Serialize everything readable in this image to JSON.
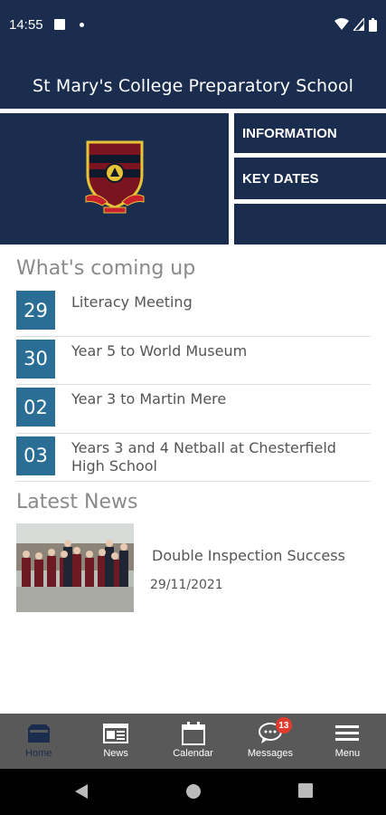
{
  "status_bar": {
    "time": "14:55"
  },
  "header": {
    "title": "St Mary's College Preparatory School"
  },
  "tiles": [
    {
      "label": "INFORMATION"
    },
    {
      "label": "KEY DATES"
    },
    {
      "label": ""
    }
  ],
  "events_section": {
    "title": "What's coming up",
    "items": [
      {
        "day": "29",
        "title": "Literacy Meeting"
      },
      {
        "day": "30",
        "title": "Year 5 to World Museum"
      },
      {
        "day": "02",
        "title": "Year 3 to Martin Mere"
      },
      {
        "day": "03",
        "title": "Years 3 and 4 Netball at Chesterfield High School"
      }
    ]
  },
  "news_section": {
    "title": "Latest News",
    "items": [
      {
        "title": "Double Inspection Success",
        "date": "29/11/2021"
      }
    ]
  },
  "bottom_nav": {
    "items": [
      {
        "label": "Home",
        "icon": "home-icon",
        "active": true
      },
      {
        "label": "News",
        "icon": "news-icon"
      },
      {
        "label": "Calendar",
        "icon": "calendar-icon"
      },
      {
        "label": "Messages",
        "icon": "messages-icon",
        "badge": "13"
      },
      {
        "label": "Menu",
        "icon": "menu-icon"
      }
    ]
  },
  "colors": {
    "brand_navy": "#1b2d4f",
    "date_blue": "#2a6e95",
    "nav_gray": "#595959",
    "badge_red": "#e23a2d"
  }
}
